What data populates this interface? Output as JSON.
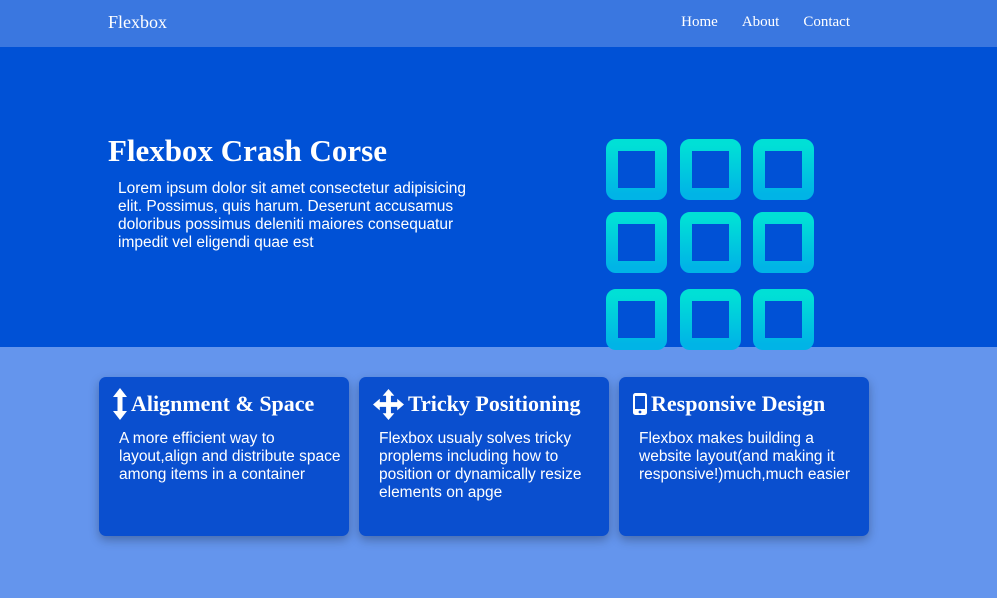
{
  "navbar": {
    "brand": "Flexbox",
    "links": [
      "Home",
      "About",
      "Contact"
    ]
  },
  "hero": {
    "title": "Flexbox Crash Corse",
    "text": "Lorem ipsum dolor sit amet consectetur adipisicing elit. Possimus, quis harum. Deserunt accusamus doloribus possimus deleniti maiores consequatur impedit vel eligendi quae est",
    "graphic_icon": "grid-icon",
    "graphic_colors": [
      "#00e0d6",
      "#00b4e6"
    ]
  },
  "features": [
    {
      "icon": "arrows-vertical-icon",
      "title": "Alignment & Space",
      "text": "A more efficient way to layout,align and distribute space among items in a container"
    },
    {
      "icon": "arrows-move-icon",
      "title": "Tricky Positioning",
      "text": "Flexbox usualy solves tricky proplems including how to position or dynamically resize elements on apge"
    },
    {
      "icon": "mobile-icon",
      "title": "Responsive Design",
      "text": "Flexbox makes building a website layout(and making it responsive!)much,much easier"
    }
  ],
  "colors": {
    "navbar": "#3a77e0",
    "hero": "#0051d6",
    "page": "#6495ed",
    "card": "#0a4fcf"
  }
}
